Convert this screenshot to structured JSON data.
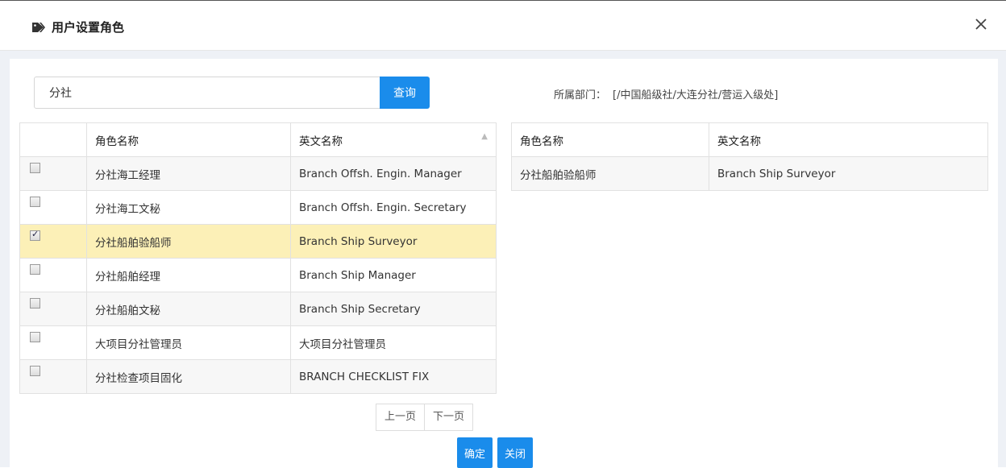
{
  "dialog": {
    "title": "用户设置角色",
    "icon": "tag-icon",
    "close_icon": "close-icon"
  },
  "search": {
    "value": "分社",
    "button_label": "查询"
  },
  "department": {
    "label": "所属部门：",
    "value": "[/中国船级社/大连分社/营运入级处]"
  },
  "left_table": {
    "headers": [
      "角色名称",
      "英文名称"
    ],
    "rows": [
      {
        "name": "分社海工经理",
        "en": "Branch Offsh. Engin. Manager",
        "checked": false
      },
      {
        "name": "分社海工文秘",
        "en": "Branch Offsh. Engin. Secretary",
        "checked": false
      },
      {
        "name": "分社船舶验船师",
        "en": "Branch Ship Surveyor",
        "checked": true
      },
      {
        "name": "分社船舶经理",
        "en": "Branch Ship Manager",
        "checked": false
      },
      {
        "name": "分社船舶文秘",
        "en": "Branch Ship Secretary",
        "checked": false
      },
      {
        "name": "大项目分社管理员",
        "en": "大项目分社管理员",
        "checked": false
      },
      {
        "name": "分社检查项目固化",
        "en": "BRANCH CHECKLIST FIX",
        "checked": false
      }
    ]
  },
  "right_table": {
    "headers": [
      "角色名称",
      "英文名称"
    ],
    "rows": [
      {
        "name": "分社船舶验船师",
        "en": "Branch Ship Surveyor"
      }
    ]
  },
  "pager": {
    "prev": "上一页",
    "next": "下一页"
  },
  "footer": {
    "confirm": "确定",
    "close": "关闭"
  },
  "colors": {
    "primary": "#1a8ceb",
    "selected_row": "#fcf0b7"
  }
}
